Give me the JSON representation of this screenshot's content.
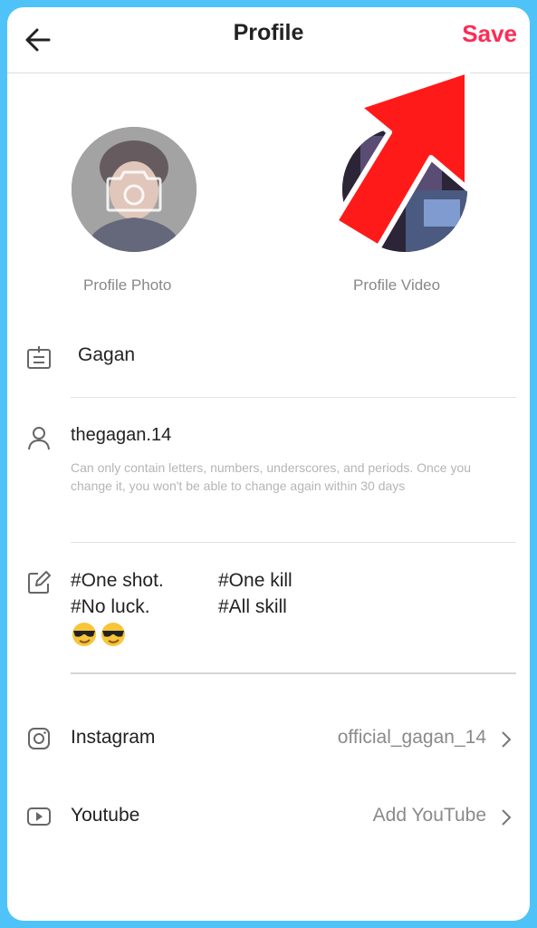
{
  "header": {
    "title": "Profile",
    "save_label": "Save"
  },
  "media": {
    "photo_label": "Profile Photo",
    "video_label": "Profile Video"
  },
  "fields": {
    "name": "Gagan",
    "username": "thegagan.14",
    "username_hint": "Can only contain letters, numbers, underscores, and periods. Once you change it, you won't be able to change again within 30 days",
    "bio_line1_a": "#One shot.",
    "bio_line1_b": "#One kill",
    "bio_line2_a": "#No luck.",
    "bio_line2_b": "#All skill",
    "bio_emoji": "😎😎"
  },
  "links": [
    {
      "label": "Instagram",
      "value": "official_gagan_14",
      "icon": "instagram-icon"
    },
    {
      "label": "Youtube",
      "value": "Add YouTube",
      "icon": "youtube-icon"
    }
  ],
  "colors": {
    "accent": "#fe2c55",
    "arrow": "#ff1a1a",
    "frame": "#4fc3f7"
  }
}
